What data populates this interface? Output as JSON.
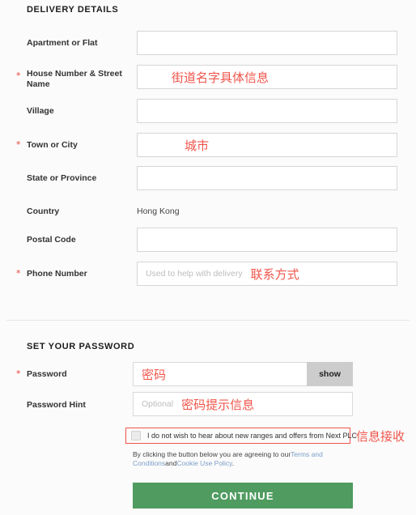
{
  "delivery": {
    "section_title": "DELIVERY DETAILS",
    "fields": [
      {
        "label": "Apartment or Flat",
        "required": false,
        "value": "",
        "placeholder": "",
        "annotation": ""
      },
      {
        "label": "House Number & Street Name",
        "required": true,
        "value": "",
        "placeholder": "",
        "annotation": "街道名字具体信息"
      },
      {
        "label": "Village",
        "required": false,
        "value": "",
        "placeholder": "",
        "annotation": ""
      },
      {
        "label": "Town or City",
        "required": true,
        "value": "",
        "placeholder": "",
        "annotation": "城市"
      },
      {
        "label": "State or Province",
        "required": false,
        "value": "",
        "placeholder": "",
        "annotation": ""
      },
      {
        "label": "Postal Code",
        "required": false,
        "value": "",
        "placeholder": "",
        "annotation": ""
      },
      {
        "label": "Phone Number",
        "required": true,
        "value": "",
        "placeholder": "Used to help with delivery",
        "annotation": "联系方式"
      }
    ],
    "country": {
      "label": "Country",
      "value": "Hong Kong"
    }
  },
  "password": {
    "section_title": "SET YOUR PASSWORD",
    "password_label": "Password",
    "password_annotation": "密码",
    "show_label": "show",
    "hint_label": "Password Hint",
    "hint_placeholder": "Optional",
    "hint_annotation": "密码提示信息"
  },
  "marketing": {
    "checkbox_label": "I do not wish to hear about new ranges and offers from Next PLC",
    "checked": false,
    "annotation": "信息接收"
  },
  "terms": {
    "prefix": "By clicking the button below you are agreeing to our",
    "link1": "Terms and Conditions",
    "conjunction": "and",
    "link2": "Cookie Use Policy",
    "suffix": "."
  },
  "actions": {
    "continue_label": "CONTINUE"
  },
  "colors": {
    "required_star": "#e8453c",
    "annotation": "#f0554b",
    "continue_bg": "#4f9b60",
    "link": "#7b9ec9"
  }
}
